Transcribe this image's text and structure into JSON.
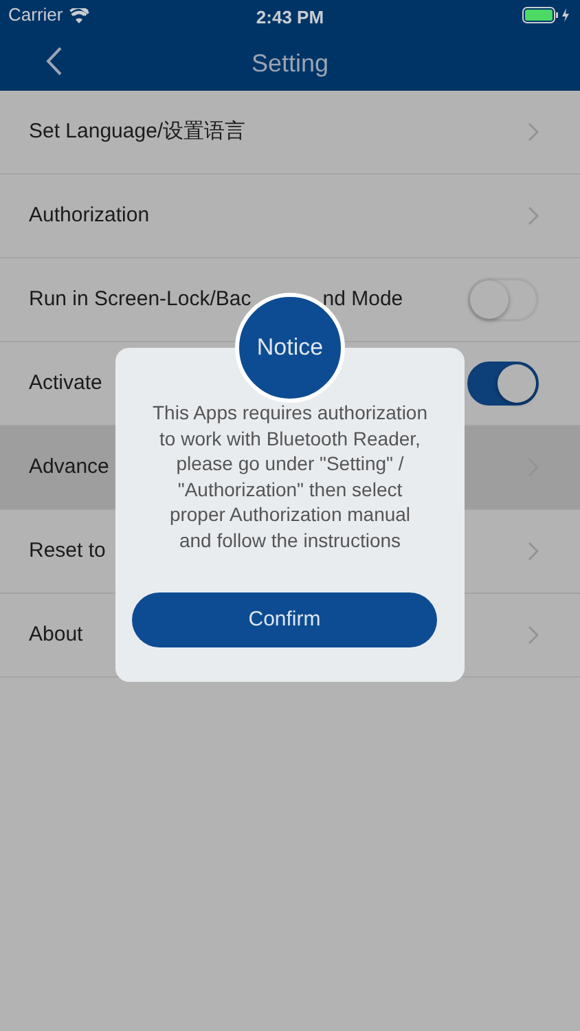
{
  "status_bar": {
    "carrier": "Carrier",
    "time": "2:43 PM"
  },
  "nav": {
    "title": "Setting"
  },
  "rows": [
    {
      "kind": "link",
      "label": "Set Language/设置语言",
      "selected": false
    },
    {
      "kind": "link",
      "label": "Authorization",
      "selected": false
    },
    {
      "kind": "toggle",
      "label": "Run in Screen-Lock/Bac",
      "label_tail": "nd Mode",
      "on": false,
      "selected": false
    },
    {
      "kind": "toggle",
      "label": "Activate",
      "on": true,
      "selected": false
    },
    {
      "kind": "link",
      "label": "Advance",
      "selected": true
    },
    {
      "kind": "link",
      "label": "Reset to",
      "selected": false
    },
    {
      "kind": "link",
      "label": "About",
      "selected": false
    }
  ],
  "dialog": {
    "badge": "Notice",
    "message": "This Apps requires authorization to work with Bluetooth Reader, please go under \"Setting\" / \"Authorization\" then select proper Authorization manual and follow the instructions",
    "button": "Confirm"
  }
}
